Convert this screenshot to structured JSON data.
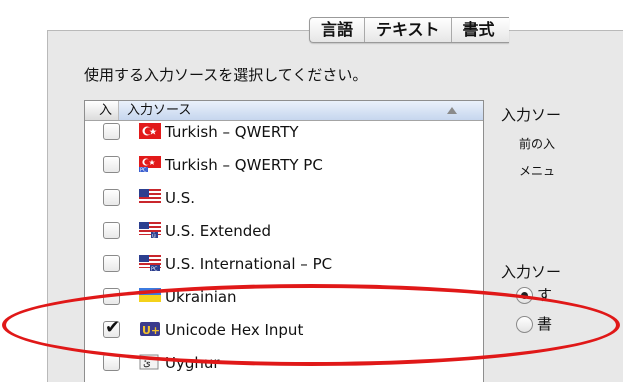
{
  "tabs": [
    {
      "label": "言語"
    },
    {
      "label": "テキスト"
    },
    {
      "label": "書式"
    }
  ],
  "instruction": "使用する入力ソースを選択してください。",
  "list": {
    "header": {
      "checkbox_col": "入",
      "source_col": "入力ソース"
    },
    "rows": [
      {
        "label": "Turkish – QWERTY",
        "checked": false,
        "icon": "turkish-flag-icon"
      },
      {
        "label": "Turkish – QWERTY PC",
        "checked": false,
        "icon": "turkish-pc-flag-icon"
      },
      {
        "label": "U.S.",
        "checked": false,
        "icon": "us-flag-icon"
      },
      {
        "label": "U.S. Extended",
        "checked": false,
        "icon": "us-extended-flag-icon"
      },
      {
        "label": "U.S. International – PC",
        "checked": false,
        "icon": "us-international-flag-icon"
      },
      {
        "label": "Ukrainian",
        "checked": false,
        "icon": "ukraine-flag-icon"
      },
      {
        "label": "Unicode Hex Input",
        "checked": true,
        "icon": "unicode-hex-icon"
      },
      {
        "label": "Uyghur",
        "checked": false,
        "icon": "uyghur-icon"
      }
    ]
  },
  "right_panel": {
    "shortcuts_heading": "入力ソー",
    "prev_source": "前の入",
    "menu_text": "メニュ",
    "options_heading": "入力ソー",
    "radio1_label": "す",
    "radio2_label": "書"
  },
  "colors": {
    "highlight_ellipse": "#e01818",
    "panel_bg": "#e8e8e8"
  }
}
